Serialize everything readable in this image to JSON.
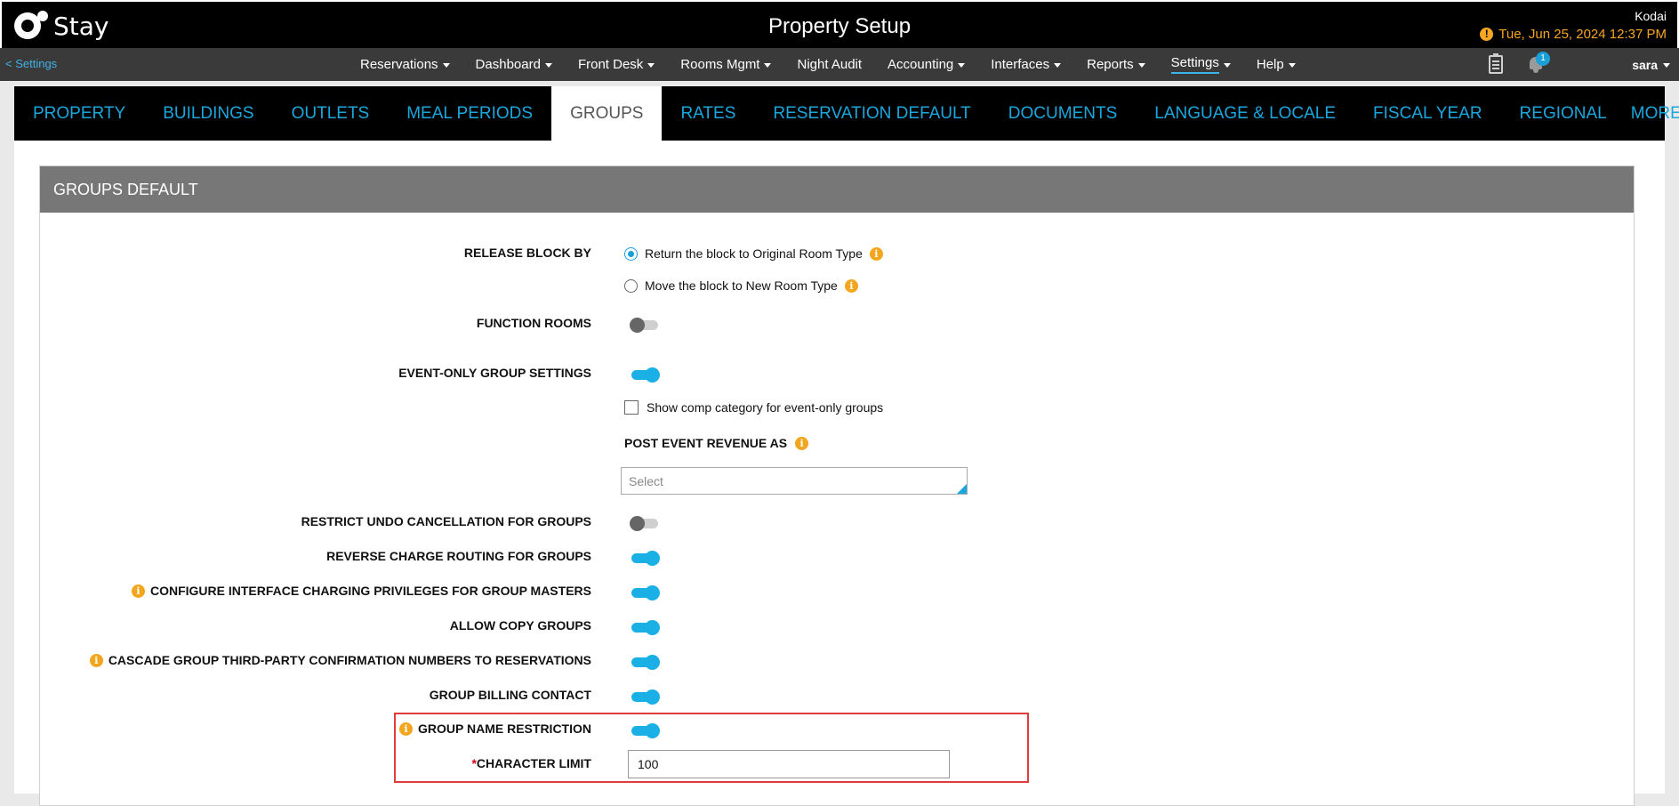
{
  "app": {
    "logo_text": "Stay",
    "page_title": "Property Setup",
    "hotel_name": "Kodai",
    "datetime": "Tue, Jun 25, 2024 12:37 PM",
    "datetime_warning_icon": "!"
  },
  "nav": {
    "back_label": "<  Settings",
    "items": [
      {
        "label": "Reservations",
        "caret": true
      },
      {
        "label": "Dashboard",
        "caret": true
      },
      {
        "label": "Front Desk",
        "caret": true
      },
      {
        "label": "Rooms Mgmt",
        "caret": true
      },
      {
        "label": "Night Audit",
        "caret": false
      },
      {
        "label": "Accounting",
        "caret": true
      },
      {
        "label": "Interfaces",
        "caret": true
      },
      {
        "label": "Reports",
        "caret": true
      },
      {
        "label": "Settings",
        "caret": true,
        "active": true
      },
      {
        "label": "Help",
        "caret": true
      }
    ],
    "notification_count": "1",
    "user": "sara"
  },
  "tabs": {
    "items": [
      "PROPERTY",
      "BUILDINGS",
      "OUTLETS",
      "MEAL PERIODS",
      "GROUPS",
      "RATES",
      "RESERVATION DEFAULT",
      "DOCUMENTS",
      "LANGUAGE & LOCALE",
      "FISCAL YEAR",
      "REGIONAL"
    ],
    "active": "GROUPS",
    "more_label": "MORE"
  },
  "panel": {
    "title": "GROUPS DEFAULT",
    "release_block": {
      "label": "RELEASE BLOCK BY",
      "option1": "Return the block to Original Room Type",
      "option2": "Move the block to New Room Type",
      "selected": "option1"
    },
    "function_rooms": {
      "label": "FUNCTION ROOMS",
      "on": false
    },
    "event_only": {
      "label": "EVENT-ONLY GROUP SETTINGS",
      "on": true,
      "checkbox_label": "Show comp category for event-only groups",
      "post_revenue_label": "POST EVENT REVENUE AS",
      "select_placeholder": "Select"
    },
    "restrict_undo": {
      "label": "RESTRICT UNDO CANCELLATION FOR GROUPS",
      "on": false
    },
    "reverse_charge": {
      "label": "REVERSE CHARGE ROUTING FOR GROUPS",
      "on": true
    },
    "interface_charging": {
      "label": "CONFIGURE INTERFACE CHARGING PRIVILEGES FOR GROUP MASTERS",
      "on": true
    },
    "allow_copy": {
      "label": "ALLOW COPY GROUPS",
      "on": true
    },
    "cascade_confirmation": {
      "label": "CASCADE GROUP THIRD-PARTY CONFIRMATION NUMBERS TO RESERVATIONS",
      "on": true
    },
    "billing_contact": {
      "label": "GROUP BILLING CONTACT",
      "on": true
    },
    "name_restriction": {
      "label": "GROUP NAME RESTRICTION",
      "on": true
    },
    "character_limit": {
      "required_mark": "*",
      "label": "CHARACTER LIMIT",
      "value": "100"
    }
  },
  "colors": {
    "accent": "#1ab0e6",
    "info": "#f2a61e",
    "highlight": "#e03c3c",
    "header_gray": "#777777"
  },
  "icons": {
    "info": "info-icon",
    "clipboard": "clipboard-icon",
    "bell": "bell-icon"
  }
}
